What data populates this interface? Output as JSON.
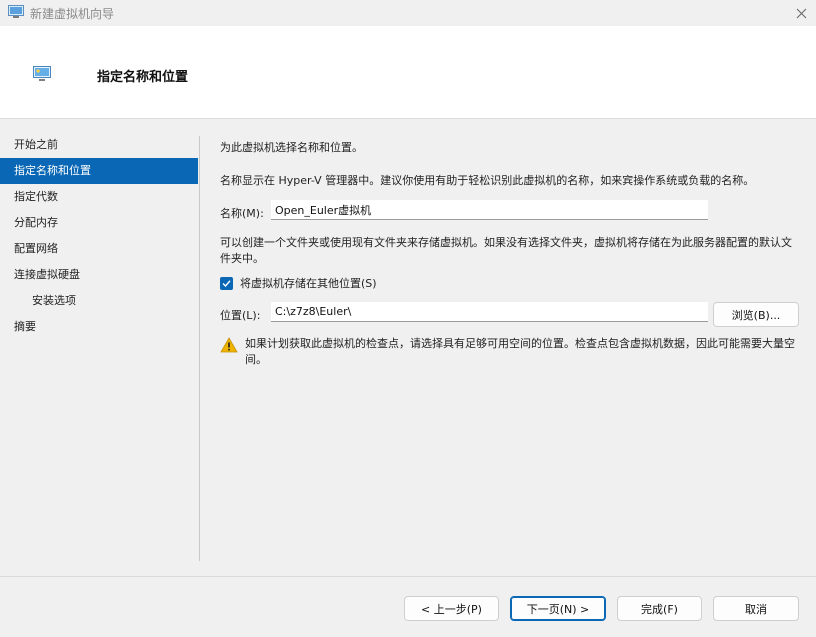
{
  "window": {
    "title": "新建虚拟机向导",
    "close_icon": "close-icon"
  },
  "header": {
    "title": "指定名称和位置",
    "icon": "wizard-icon"
  },
  "sidebar": {
    "items": [
      {
        "label": "开始之前",
        "active": false
      },
      {
        "label": "指定名称和位置",
        "active": true
      },
      {
        "label": "指定代数",
        "active": false
      },
      {
        "label": "分配内存",
        "active": false
      },
      {
        "label": "配置网络",
        "active": false
      },
      {
        "label": "连接虚拟硬盘",
        "active": false
      },
      {
        "label": "安装选项",
        "active": false
      },
      {
        "label": "摘要",
        "active": false
      }
    ]
  },
  "content": {
    "intro": "为此虚拟机选择名称和位置。",
    "name_hint": "名称显示在 Hyper-V 管理器中。建议你使用有助于轻松识别此虚拟机的名称，如来宾操作系统或负载的名称。",
    "name_label": "名称(M):",
    "name_value": "Open_Euler虚拟机",
    "folder_hint_line1": "可以创建一个文件夹或使用现有文件夹来存储虚拟机。如果没有选择文件夹，虚拟机将存储在为此服务器配置的默认文",
    "folder_hint_line2": "件夹中。",
    "checkbox_label": "将虚拟机存储在其他位置(S)",
    "checkbox_checked": true,
    "location_label": "位置(L):",
    "location_value": "C:\\z7z8\\Euler\\",
    "browse_label": "浏览(B)...",
    "warning_line1": "如果计划获取此虚拟机的检查点，请选择具有足够可用空间的位置。检查点包含虚拟机数据，因此可能需要大量空",
    "warning_line2": "间。"
  },
  "footer": {
    "prev_label": "< 上一步(P)",
    "next_label": "下一页(N) >",
    "finish_label": "完成(F)",
    "cancel_label": "取消"
  },
  "colors": {
    "accent": "#0a67b5",
    "warning": "#f0b400"
  }
}
